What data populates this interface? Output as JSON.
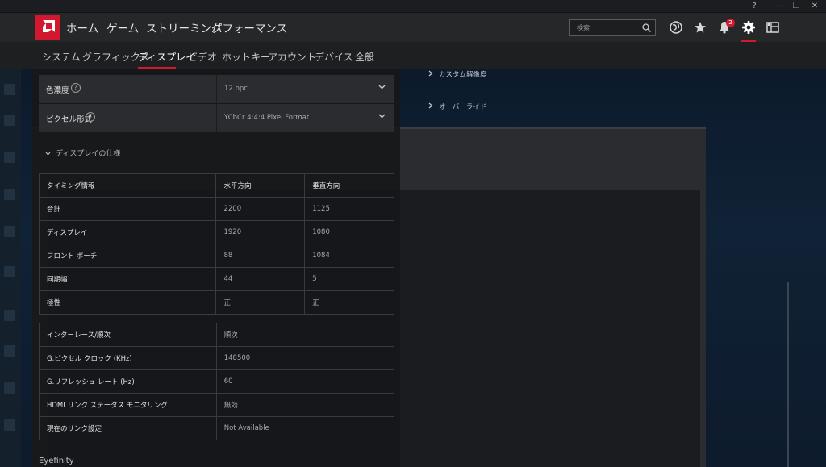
{
  "window": {
    "help_glyph": "?",
    "minimize_glyph": "—",
    "restore_glyph": "❐",
    "close_glyph": "✕"
  },
  "main_nav": {
    "items": [
      "ホーム",
      "ゲーム",
      "ストリーミング",
      "パフォーマンス"
    ],
    "search_placeholder": "検索",
    "notification_count": "2",
    "accent_color": "#d1182f"
  },
  "sub_nav": {
    "items": [
      "システム",
      "グラフィックス",
      "ディスプレイ",
      "ビデオ",
      "ホットキー",
      "アカウント",
      "デバイス",
      "全般"
    ],
    "active": "ディスプレイ"
  },
  "settings": {
    "color_depth": {
      "label": "色濃度",
      "value": "12 bpc"
    },
    "pixel_format": {
      "label": "ピクセル形式",
      "value": "YCbCr 4:4:4 Pixel Format"
    }
  },
  "spec_section": {
    "title": "ディスプレイの仕様",
    "timing_header": [
      "タイミング情報",
      "水平方向",
      "垂直方向"
    ],
    "timing_rows": [
      [
        "合計",
        "2200",
        "1125"
      ],
      [
        "ディスプレイ",
        "1920",
        "1080"
      ],
      [
        "フロント ポーチ",
        "88",
        "1084"
      ],
      [
        "同期幅",
        "44",
        "5"
      ],
      [
        "極性",
        "正",
        "正"
      ]
    ],
    "info_rows": [
      [
        "インターレース/順次",
        "順次"
      ],
      [
        "G.ピクセル クロック (KHz)",
        "148500"
      ],
      [
        "G.リフレッシュ レート (Hz)",
        "60"
      ],
      [
        "HDMI リンク ステータス モニタリング",
        "無効"
      ],
      [
        "現在のリンク設定",
        "Not Available"
      ]
    ]
  },
  "eyefinity": {
    "label": "Eyefinity"
  },
  "side_links": [
    "カスタム解像度",
    "オーバーライド"
  ]
}
